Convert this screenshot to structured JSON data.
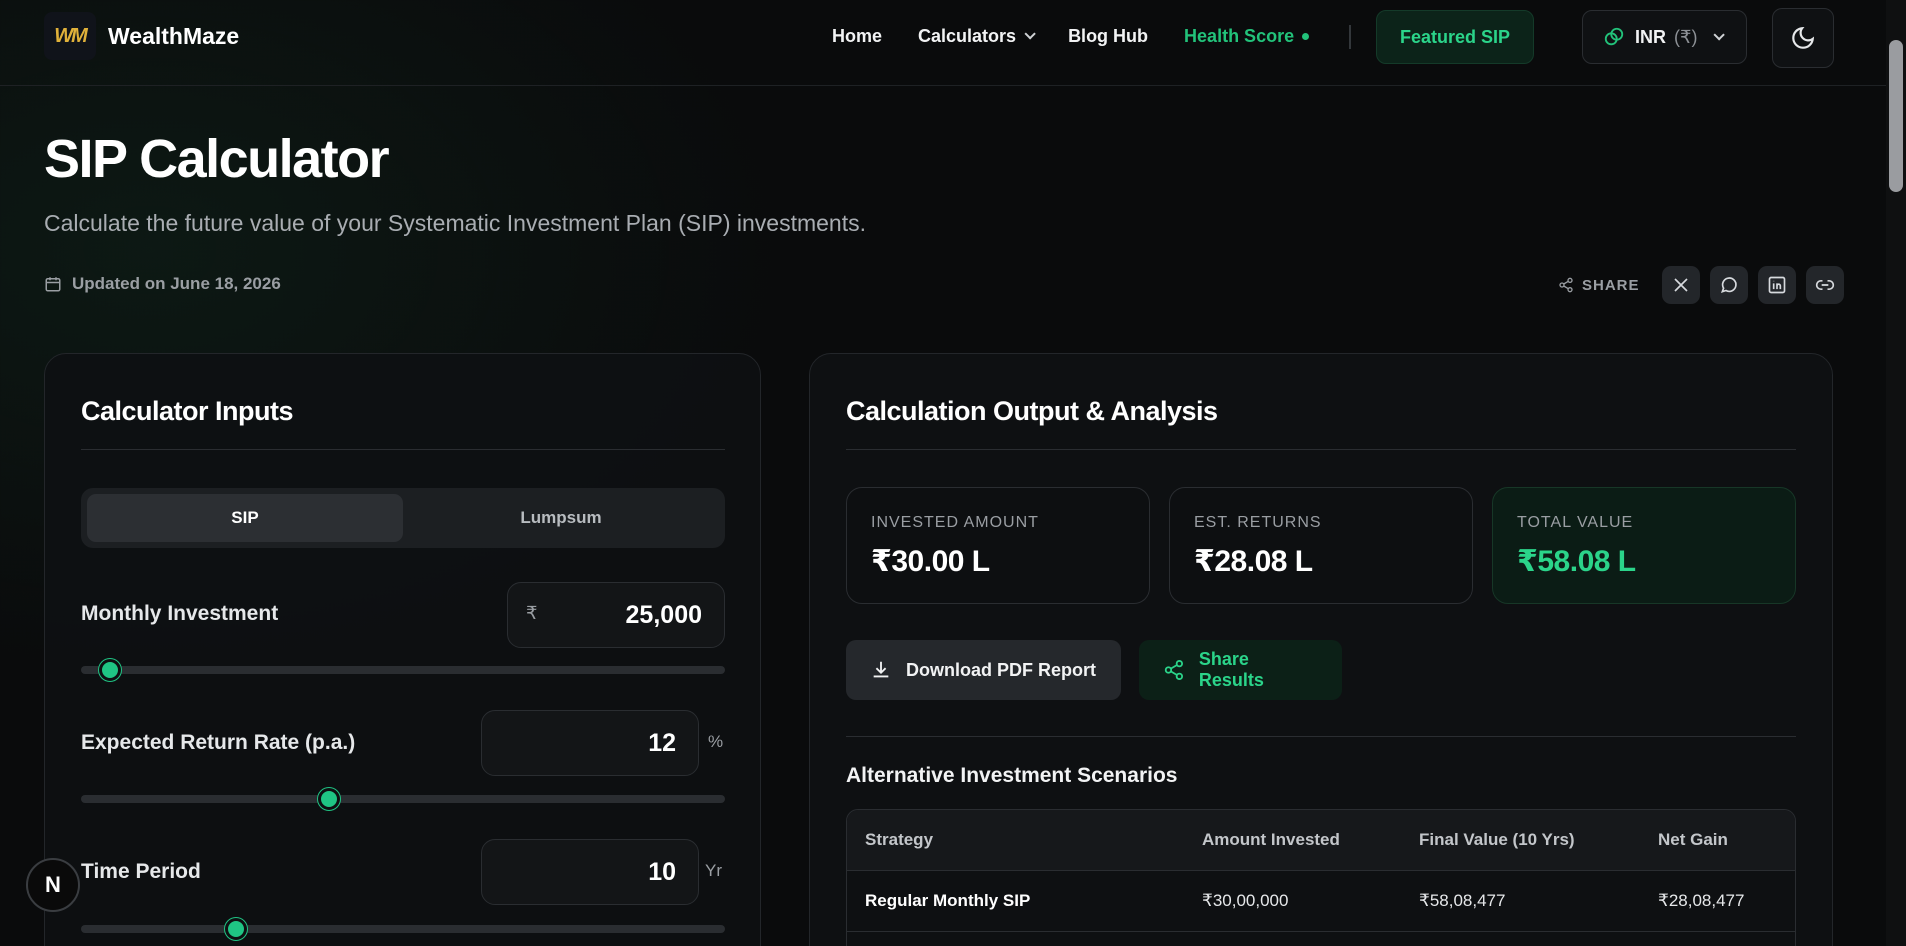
{
  "brand": {
    "name": "WealthMaze",
    "logo_text": "WM"
  },
  "nav": {
    "links": [
      {
        "label": "Home"
      },
      {
        "label": "Calculators"
      },
      {
        "label": "Blog Hub"
      },
      {
        "label": "Health Score"
      }
    ],
    "featured_label": "Featured SIP",
    "currency_code": "INR",
    "currency_symbol": "(₹)"
  },
  "page": {
    "title": "SIP Calculator",
    "subtitle": "Calculate the future value of your Systematic Investment Plan (SIP) investments.",
    "updated": "Updated on June 18, 2026",
    "share_label": "SHARE"
  },
  "inputs": {
    "title": "Calculator Inputs",
    "mode_tabs": [
      "SIP",
      "Lumpsum"
    ],
    "active_mode": "SIP",
    "monthly": {
      "label": "Monthly Investment",
      "prefix": "₹",
      "value": "25,000",
      "slider_fraction": 0.045
    },
    "rate": {
      "label": "Expected Return Rate (p.a.)",
      "value": "12",
      "unit": "%",
      "slider_fraction": 0.385
    },
    "time": {
      "label": "Time Period",
      "value": "10",
      "unit": "Yr",
      "slider_fraction": 0.24
    }
  },
  "output": {
    "title": "Calculation Output & Analysis",
    "stats": [
      {
        "label": "INVESTED AMOUNT",
        "value": "₹30.00 L"
      },
      {
        "label": "EST. RETURNS",
        "value": "₹28.08 L"
      },
      {
        "label": "TOTAL VALUE",
        "value": "₹58.08 L"
      }
    ],
    "download_label": "Download PDF Report",
    "share_label": "Share Results",
    "alt_title": "Alternative Investment Scenarios",
    "table": {
      "headers": [
        "Strategy",
        "Amount Invested",
        "Final Value (10 Yrs)",
        "Net Gain"
      ],
      "rows": [
        [
          "Regular Monthly SIP",
          "₹30,00,000",
          "₹58,08,477",
          "₹28,08,477"
        ]
      ]
    }
  },
  "colors": {
    "accent": "#22c27a",
    "background": "#0a0b0c"
  },
  "badge_letter": "N"
}
